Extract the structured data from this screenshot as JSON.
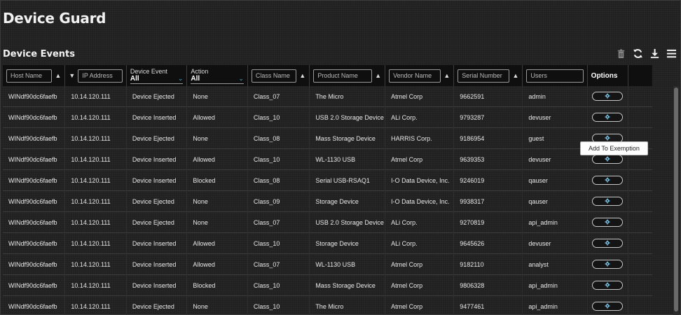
{
  "page": {
    "title": "Device Guard"
  },
  "section": {
    "title": "Device Events"
  },
  "toolbar": {
    "icons": [
      "trash-icon",
      "refresh-icon",
      "download-icon",
      "list-icon"
    ]
  },
  "filters": {
    "host_name": "Host Name",
    "ip_address": "IP Address",
    "device_event_label": "Device Event",
    "device_event_value": "All",
    "action_label": "Action",
    "action_value": "All",
    "class_name": "Class Name",
    "product_name": "Product Name",
    "vendor_name": "Vendor Name",
    "serial_number": "Serial Number",
    "users": "Users",
    "options_label": "Options"
  },
  "rows": [
    {
      "host": "WINdf90dc6faefb",
      "ip": "10.14.120.111",
      "event": "Device Ejected",
      "action": "None",
      "class": "Class_07",
      "product": "The Micro",
      "vendor": "Atmel Corp",
      "serial": "9662591",
      "user": "admin"
    },
    {
      "host": "WINdf90dc6faefb",
      "ip": "10.14.120.111",
      "event": "Device Inserted",
      "action": "Allowed",
      "class": "Class_10",
      "product": "USB 2.0 Storage Device",
      "vendor": "ALi Corp.",
      "serial": "9793287",
      "user": "devuser"
    },
    {
      "host": "WINdf90dc6faefb",
      "ip": "10.14.120.111",
      "event": "Device Ejected",
      "action": "None",
      "class": "Class_08",
      "product": "Mass Storage Device",
      "vendor": "HARRIS Corp.",
      "serial": "9186954",
      "user": "guest"
    },
    {
      "host": "WINdf90dc6faefb",
      "ip": "10.14.120.111",
      "event": "Device Inserted",
      "action": "Allowed",
      "class": "Class_10",
      "product": "WL-1130 USB",
      "vendor": "Atmel Corp",
      "serial": "9639353",
      "user": "devuser"
    },
    {
      "host": "WINdf90dc6faefb",
      "ip": "10.14.120.111",
      "event": "Device Inserted",
      "action": "Blocked",
      "class": "Class_08",
      "product": "Serial USB-RSAQ1",
      "vendor": "I-O Data Device, Inc.",
      "serial": "9246019",
      "user": "qauser"
    },
    {
      "host": "WINdf90dc6faefb",
      "ip": "10.14.120.111",
      "event": "Device Ejected",
      "action": "None",
      "class": "Class_09",
      "product": "Storage Device",
      "vendor": "I-O Data Device, Inc.",
      "serial": "9938317",
      "user": "qauser"
    },
    {
      "host": "WINdf90dc6faefb",
      "ip": "10.14.120.111",
      "event": "Device Ejected",
      "action": "None",
      "class": "Class_07",
      "product": "USB 2.0 Storage Device",
      "vendor": "ALi Corp.",
      "serial": "9270819",
      "user": "api_admin"
    },
    {
      "host": "WINdf90dc6faefb",
      "ip": "10.14.120.111",
      "event": "Device Inserted",
      "action": "Allowed",
      "class": "Class_10",
      "product": "Storage Device",
      "vendor": "ALi Corp.",
      "serial": "9645626",
      "user": "devuser"
    },
    {
      "host": "WINdf90dc6faefb",
      "ip": "10.14.120.111",
      "event": "Device Inserted",
      "action": "Allowed",
      "class": "Class_07",
      "product": "WL-1130 USB",
      "vendor": "Atmel Corp",
      "serial": "9182110",
      "user": "analyst"
    },
    {
      "host": "WINdf90dc6faefb",
      "ip": "10.14.120.111",
      "event": "Device Inserted",
      "action": "Blocked",
      "class": "Class_10",
      "product": "Mass Storage Device",
      "vendor": "Atmel Corp",
      "serial": "9806328",
      "user": "api_admin"
    },
    {
      "host": "WINdf90dc6faefb",
      "ip": "10.14.120.111",
      "event": "Device Ejected",
      "action": "None",
      "class": "Class_10",
      "product": "The Micro",
      "vendor": "Atmel Corp",
      "serial": "9477461",
      "user": "api_admin"
    }
  ],
  "tooltip": {
    "text": "Add To Exemption"
  },
  "colors": {
    "accent": "#4aa9d8",
    "background": "#202020",
    "header": "#0f0f0f"
  }
}
